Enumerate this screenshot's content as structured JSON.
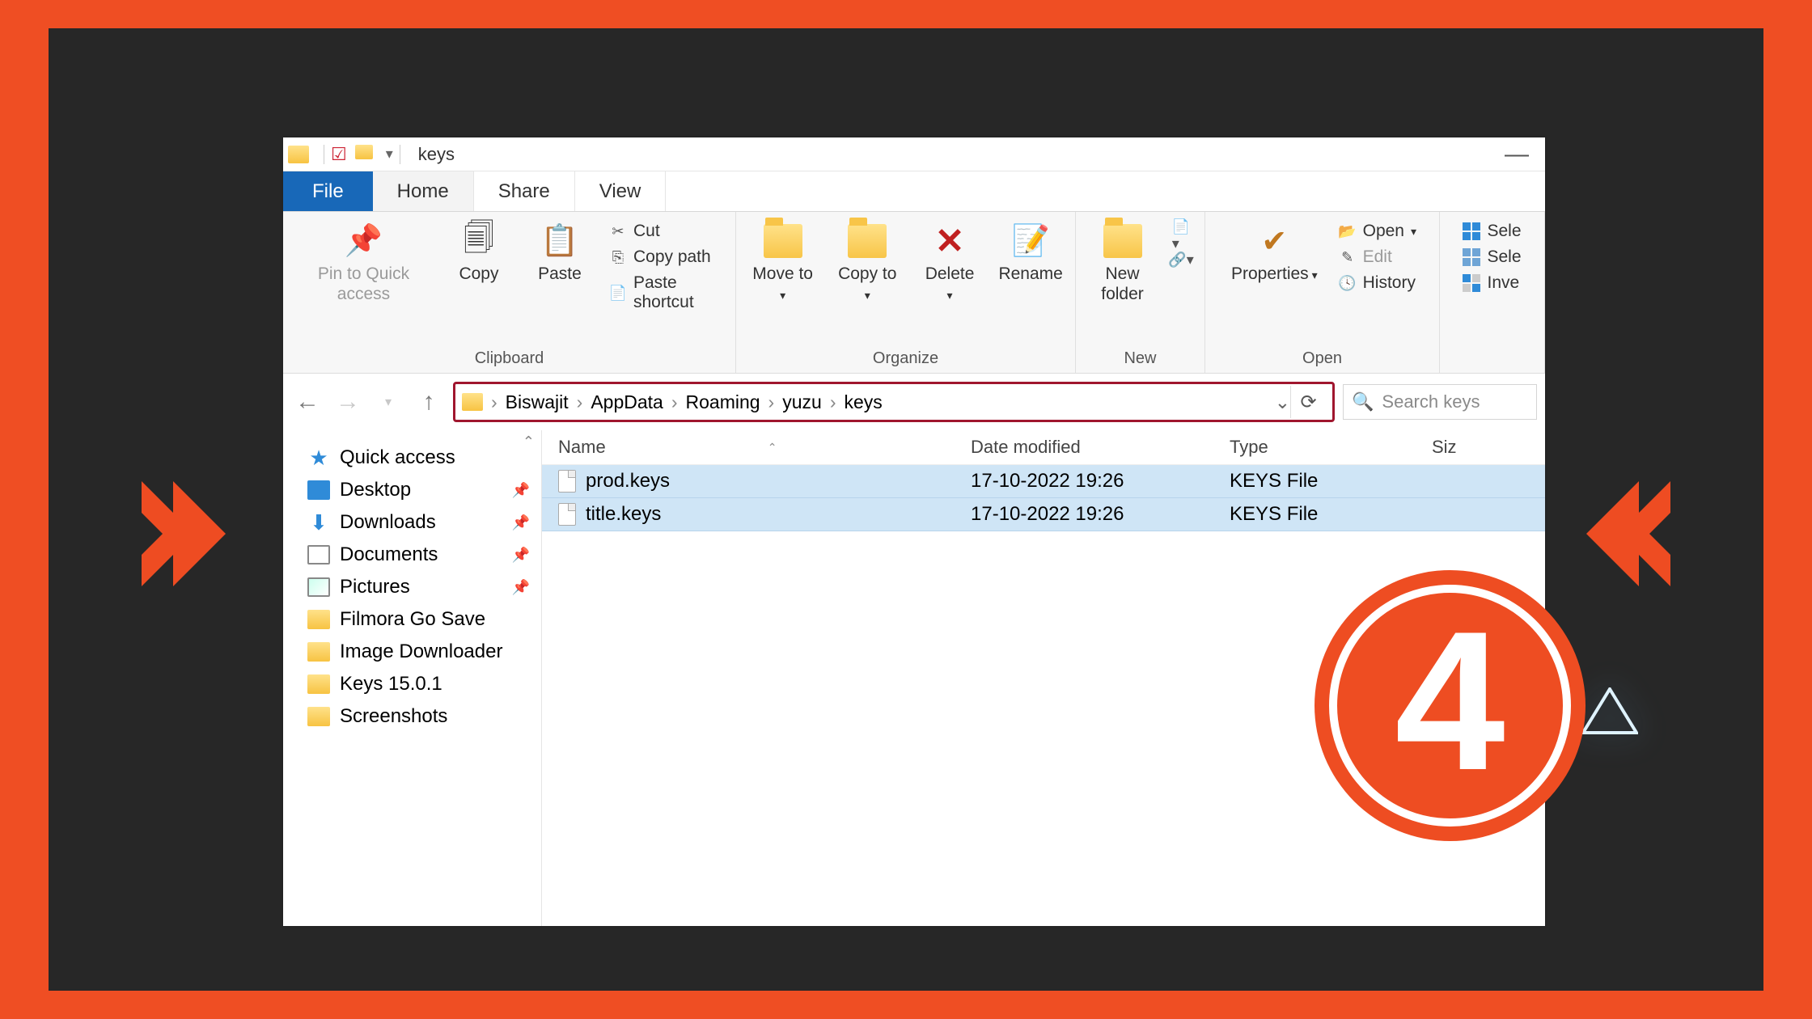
{
  "colors": {
    "accent": "#ee4c22",
    "dark": "#272727",
    "ribbon_blue": "#1868b8"
  },
  "step_badge": "4",
  "window": {
    "title": "keys"
  },
  "tabs": {
    "file": "File",
    "home": "Home",
    "share": "Share",
    "view": "View"
  },
  "ribbon": {
    "clipboard": {
      "label": "Clipboard",
      "pin": "Pin to Quick access",
      "copy": "Copy",
      "paste": "Paste",
      "cut": "Cut",
      "copy_path": "Copy path",
      "paste_shortcut": "Paste shortcut"
    },
    "organize": {
      "label": "Organize",
      "move_to": "Move to",
      "copy_to": "Copy to",
      "delete": "Delete",
      "rename": "Rename"
    },
    "new": {
      "label": "New",
      "new_folder": "New folder"
    },
    "open": {
      "label": "Open",
      "properties": "Properties",
      "open": "Open",
      "edit": "Edit",
      "history": "History"
    },
    "select": {
      "select_all": "Sele",
      "select_none": "Sele",
      "invert": "Inve"
    }
  },
  "breadcrumb": [
    "Biswajit",
    "AppData",
    "Roaming",
    "yuzu",
    "keys"
  ],
  "search_placeholder": "Search keys",
  "columns": {
    "name": "Name",
    "modified": "Date modified",
    "type": "Type",
    "size": "Siz"
  },
  "files": [
    {
      "name": "prod.keys",
      "modified": "17-10-2022 19:26",
      "type": "KEYS File"
    },
    {
      "name": "title.keys",
      "modified": "17-10-2022 19:26",
      "type": "KEYS File"
    }
  ],
  "sidebar": {
    "quick_access": "Quick access",
    "items": [
      {
        "label": "Desktop",
        "icon": "desktop",
        "pinned": true
      },
      {
        "label": "Downloads",
        "icon": "down",
        "pinned": true
      },
      {
        "label": "Documents",
        "icon": "doc",
        "pinned": true
      },
      {
        "label": "Pictures",
        "icon": "pic",
        "pinned": true
      },
      {
        "label": "Filmora Go Save",
        "icon": "fld"
      },
      {
        "label": "Image Downloader",
        "icon": "fld"
      },
      {
        "label": "Keys 15.0.1",
        "icon": "fld"
      },
      {
        "label": "Screenshots",
        "icon": "fld"
      }
    ]
  }
}
